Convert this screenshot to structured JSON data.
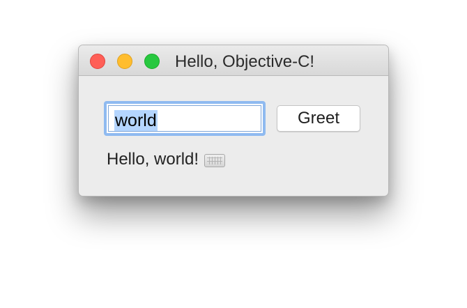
{
  "window": {
    "title": "Hello, Objective-C!",
    "controls": {
      "close": "close-button",
      "minimize": "minimize-button",
      "zoom": "zoom-button"
    }
  },
  "form": {
    "name_value": "world",
    "greet_label": "Greet",
    "result_text": "Hello, world!",
    "result_icon": "keyboard-icon"
  },
  "colors": {
    "close": "#ff5f57",
    "minimize": "#ffbd2e",
    "zoom": "#28c840",
    "selection": "#b4d5fe",
    "focus_ring": "#8fbaf0"
  }
}
